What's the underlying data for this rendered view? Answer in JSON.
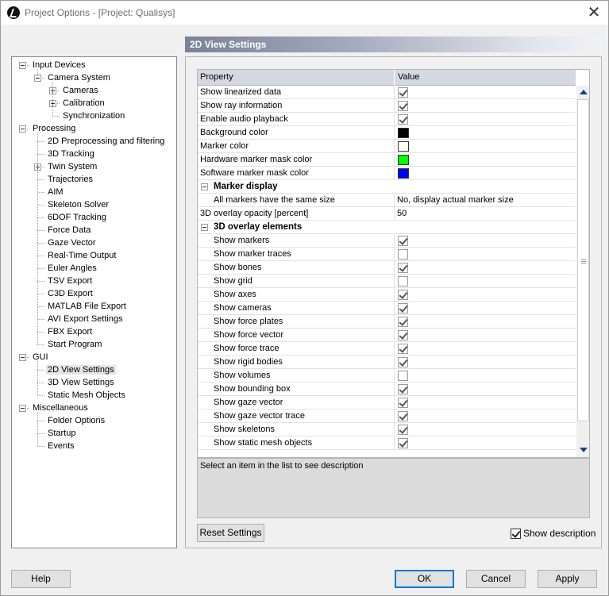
{
  "window": {
    "title": "Project Options - [Project: Qualisys]"
  },
  "tree": [
    {
      "label": "Input Devices",
      "level": 0,
      "toggle": "minus"
    },
    {
      "label": "Camera System",
      "level": 1,
      "toggle": "minus"
    },
    {
      "label": "Cameras",
      "level": 2,
      "toggle": "plus"
    },
    {
      "label": "Calibration",
      "level": 2,
      "toggle": "plus"
    },
    {
      "label": "Synchronization",
      "level": 2,
      "toggle": "none"
    },
    {
      "label": "Processing",
      "level": 0,
      "toggle": "minus"
    },
    {
      "label": "2D Preprocessing and filtering",
      "level": 1,
      "toggle": "none"
    },
    {
      "label": "3D Tracking",
      "level": 1,
      "toggle": "none"
    },
    {
      "label": "Twin System",
      "level": 1,
      "toggle": "plus"
    },
    {
      "label": "Trajectories",
      "level": 1,
      "toggle": "none"
    },
    {
      "label": "AIM",
      "level": 1,
      "toggle": "none"
    },
    {
      "label": "Skeleton Solver",
      "level": 1,
      "toggle": "none"
    },
    {
      "label": "6DOF Tracking",
      "level": 1,
      "toggle": "none"
    },
    {
      "label": "Force Data",
      "level": 1,
      "toggle": "none"
    },
    {
      "label": "Gaze Vector",
      "level": 1,
      "toggle": "none"
    },
    {
      "label": "Real-Time Output",
      "level": 1,
      "toggle": "none"
    },
    {
      "label": "Euler Angles",
      "level": 1,
      "toggle": "none"
    },
    {
      "label": "TSV Export",
      "level": 1,
      "toggle": "none"
    },
    {
      "label": "C3D Export",
      "level": 1,
      "toggle": "none"
    },
    {
      "label": "MATLAB File Export",
      "level": 1,
      "toggle": "none"
    },
    {
      "label": "AVI Export Settings",
      "level": 1,
      "toggle": "none"
    },
    {
      "label": "FBX Export",
      "level": 1,
      "toggle": "none"
    },
    {
      "label": "Start Program",
      "level": 1,
      "toggle": "none"
    },
    {
      "label": "GUI",
      "level": 0,
      "toggle": "minus"
    },
    {
      "label": "2D View Settings",
      "level": 1,
      "toggle": "none",
      "selected": true
    },
    {
      "label": "3D View Settings",
      "level": 1,
      "toggle": "none"
    },
    {
      "label": "Static Mesh Objects",
      "level": 1,
      "toggle": "none"
    },
    {
      "label": "Miscellaneous",
      "level": 0,
      "toggle": "minus"
    },
    {
      "label": "Folder Options",
      "level": 1,
      "toggle": "none"
    },
    {
      "label": "Startup",
      "level": 1,
      "toggle": "none"
    },
    {
      "label": "Events",
      "level": 1,
      "toggle": "none"
    }
  ],
  "panel": {
    "title": "2D View Settings"
  },
  "grid": {
    "headers": {
      "property": "Property",
      "value": "Value"
    },
    "rows": [
      {
        "type": "check",
        "label": "Show linearized data",
        "checked": true
      },
      {
        "type": "check",
        "label": "Show ray information",
        "checked": true
      },
      {
        "type": "check",
        "label": "Enable audio playback",
        "checked": true
      },
      {
        "type": "color",
        "label": "Background color",
        "color": "#000000"
      },
      {
        "type": "color",
        "label": "Marker color",
        "color": "#ffffff"
      },
      {
        "type": "color",
        "label": "Hardware marker mask color",
        "color": "#00ff00"
      },
      {
        "type": "color",
        "label": "Software marker mask color",
        "color": "#0000ff"
      },
      {
        "type": "category",
        "label": "Marker display"
      },
      {
        "type": "text",
        "label": "All markers have the same size",
        "value": "No, display actual marker size",
        "indent": true
      },
      {
        "type": "text",
        "label": "3D overlay opacity [percent]",
        "value": "50"
      },
      {
        "type": "category",
        "label": "3D overlay elements"
      },
      {
        "type": "check",
        "label": "Show markers",
        "checked": true,
        "indent": true
      },
      {
        "type": "check",
        "label": "Show marker traces",
        "checked": false,
        "indent": true
      },
      {
        "type": "check",
        "label": "Show bones",
        "checked": true,
        "indent": true
      },
      {
        "type": "check",
        "label": "Show grid",
        "checked": false,
        "indent": true
      },
      {
        "type": "check",
        "label": "Show axes",
        "checked": true,
        "indent": true
      },
      {
        "type": "check",
        "label": "Show cameras",
        "checked": true,
        "indent": true
      },
      {
        "type": "check",
        "label": "Show force plates",
        "checked": true,
        "indent": true
      },
      {
        "type": "check",
        "label": "Show force vector",
        "checked": true,
        "indent": true
      },
      {
        "type": "check",
        "label": "Show force trace",
        "checked": true,
        "indent": true
      },
      {
        "type": "check",
        "label": "Show rigid bodies",
        "checked": true,
        "indent": true
      },
      {
        "type": "check",
        "label": "Show volumes",
        "checked": false,
        "indent": true
      },
      {
        "type": "check",
        "label": "Show bounding box",
        "checked": true,
        "indent": true
      },
      {
        "type": "check",
        "label": "Show gaze vector",
        "checked": true,
        "indent": true
      },
      {
        "type": "check",
        "label": "Show gaze vector trace",
        "checked": true,
        "indent": true
      },
      {
        "type": "check",
        "label": "Show skeletons",
        "checked": true,
        "indent": true
      },
      {
        "type": "check",
        "label": "Show static mesh objects",
        "checked": true,
        "indent": true
      }
    ]
  },
  "description": "Select an item in the list to see description",
  "buttons": {
    "reset": "Reset Settings",
    "show_description": "Show description",
    "help": "Help",
    "ok": "OK",
    "cancel": "Cancel",
    "apply": "Apply"
  }
}
